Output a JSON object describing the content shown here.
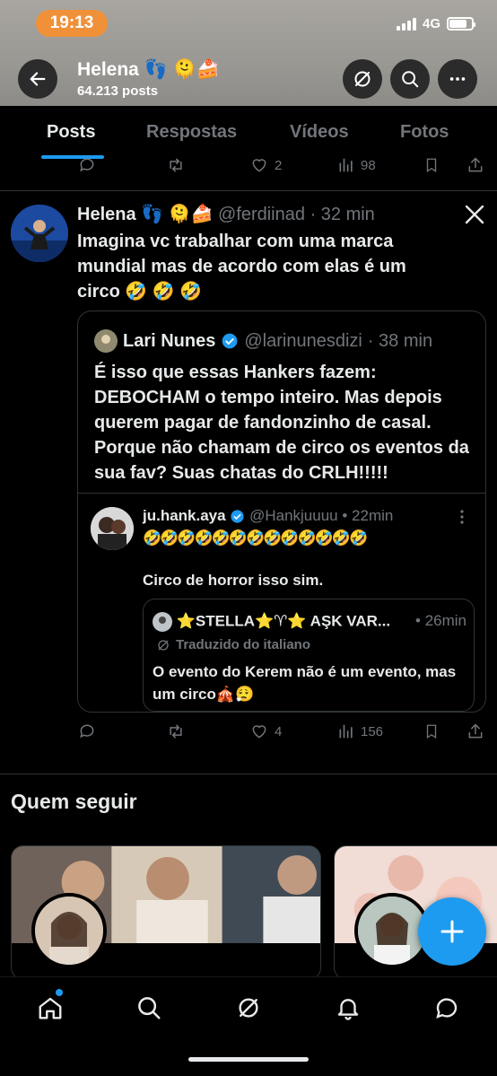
{
  "status": {
    "time": "19:13",
    "network": "4G"
  },
  "header": {
    "name": "Helena 👣 🫠🍰",
    "post_count": "64.213 posts"
  },
  "tabs": [
    {
      "label": "Posts"
    },
    {
      "label": "Respostas"
    },
    {
      "label": "Vídeos"
    },
    {
      "label": "Fotos"
    }
  ],
  "prev_actions": {
    "likes": "2",
    "views": "98"
  },
  "post": {
    "author_name": "Helena 👣 🫠🍰",
    "author_handle": "@ferdiinad",
    "time": "· 32 min",
    "text": "Imagina vc trabalhar com uma marca mundial mas de acordo com elas é um circo 🤣 🤣 🤣",
    "likes": "4",
    "views": "156"
  },
  "quote1": {
    "author_name": "Lari Nunes",
    "author_handle": "@larinunesdizi",
    "time": "· 38 min",
    "text": "É isso que essas Hankers fazem: DEBOCHAM o tempo inteiro. Mas depois querem pagar de fandonzinho de casal. Porque não chamam de circo os eventos da sua fav?  Suas chatas do CRLH!!!!!"
  },
  "quote2": {
    "author_name": "ju.hank.aya",
    "author_handle": "@Hankjuuuu",
    "time": "• 22min",
    "emojis": "🤣🤣🤣🤣🤣🤣🤣🤣🤣🤣🤣🤣🤣",
    "text": "Circo de horror isso sim."
  },
  "quote3": {
    "author_name": "⭐STELLA⭐♈⭐ AŞK VAR...",
    "time": "• 26min",
    "translated": "Traduzido do italiano",
    "text": "O evento do Kerem não é um evento, mas um circo🎪😮‍💨"
  },
  "who_to_follow": {
    "title": "Quem seguir"
  },
  "colors": {
    "accent": "#1d9bf0",
    "background": "#000000",
    "muted": "#71767b",
    "time_pill": "#f0913a"
  }
}
